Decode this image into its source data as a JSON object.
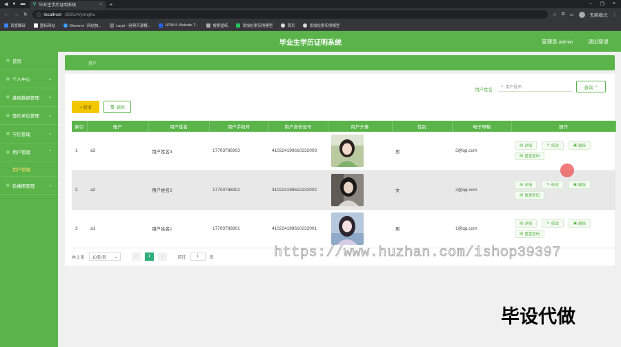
{
  "browser": {
    "tab_title": "毕业生学历证明系统",
    "address_host": "localhost",
    "address_path": ":8081/#/yonghu",
    "profile_label": "无痕模式",
    "bookmarks": [
      "百度翻译",
      "图标网站",
      "Element - 网站快...",
      "Layui - 经典开源模...",
      "HTML5 Website T...",
      "搜索壁纸",
      "添加检索实例模型",
      "首页",
      "添加检索实例模型"
    ]
  },
  "app": {
    "title": "毕业生学历证明系统",
    "user": "管理员 admin",
    "logout": "退出登录"
  },
  "sidebar": {
    "items": [
      {
        "label": "首页",
        "expandable": false
      },
      {
        "label": "个人中心",
        "expandable": true
      },
      {
        "label": "基础数据管理",
        "expandable": true
      },
      {
        "label": "签约单位管理",
        "expandable": true
      },
      {
        "label": "学历管理",
        "expandable": true
      },
      {
        "label": "用户管理",
        "expandable": true
      }
    ],
    "active_sub": "用户管理",
    "last_item": {
      "label": "轮播图管理",
      "expandable": true
    }
  },
  "breadcrumb": "用户",
  "search": {
    "label": "用户姓名",
    "placeholder": "用户姓名",
    "button": "查询"
  },
  "actions": {
    "add": "+ 新增",
    "delete": "删除"
  },
  "table": {
    "headers": [
      "索引",
      "账户",
      "用户姓名",
      "用户手机号",
      "用户身份证号",
      "用户头像",
      "性别",
      "电子邮箱",
      "操作"
    ],
    "rows": [
      {
        "index": "1",
        "account": "a3",
        "name": "用户姓名3",
        "phone": "17703786903",
        "idcard": "410224199610232003",
        "gender": "男",
        "email": "3@qq.com"
      },
      {
        "index": "2",
        "account": "a2",
        "name": "用户姓名2",
        "phone": "17703786902",
        "idcard": "410224199610232002",
        "gender": "女",
        "email": "2@qq.com"
      },
      {
        "index": "3",
        "account": "a1",
        "name": "用户姓名1",
        "phone": "17703786901",
        "idcard": "410224199610232001",
        "gender": "男",
        "email": "1@qq.com"
      }
    ],
    "ops": {
      "detail": "详情",
      "edit": "修改",
      "delete": "删除",
      "reset": "重置密码"
    }
  },
  "pager": {
    "total": "共 3 条",
    "page_size": "10条/页",
    "current": "1",
    "goto_label": "前往",
    "goto_value": "1",
    "page_unit": "页"
  },
  "watermark": {
    "url": "https://www.huzhan.com/ishop39397",
    "text": "毕设代做"
  },
  "colors": {
    "brand": "#5ab44a",
    "add_button": "#f2c700",
    "pager_active": "#2fae7b"
  }
}
